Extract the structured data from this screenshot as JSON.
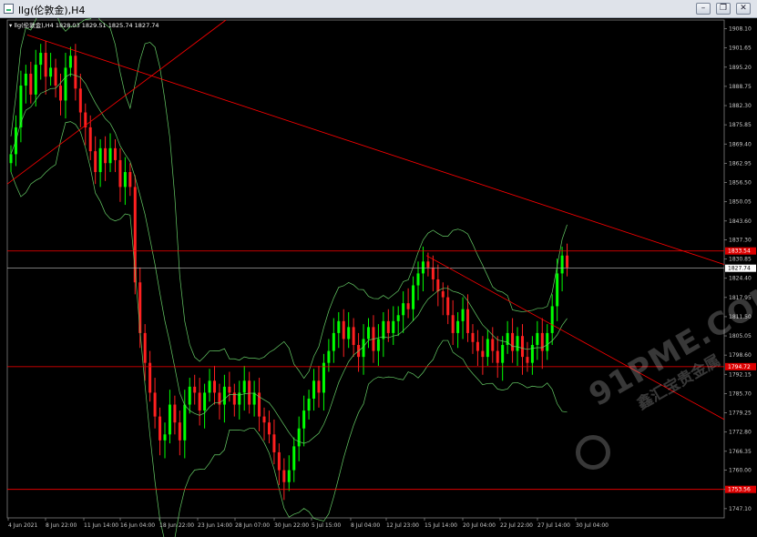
{
  "window": {
    "title": "llg(伦敦金),H4",
    "minimize_glyph": "–",
    "restore_glyph": "❐",
    "close_glyph": "✕"
  },
  "chart_info": {
    "symbol": "llg(伦敦金),H4",
    "ohlc": "1828.03 1829.51 1825.74 1827.74"
  },
  "chart_data": {
    "type": "candlestick",
    "timeframe": "H4",
    "price_ticks": [
      "1908.10",
      "1901.65",
      "1895.20",
      "1888.75",
      "1882.30",
      "1875.85",
      "1869.40",
      "1862.95",
      "1856.50",
      "1850.05",
      "1843.60",
      "1837.30",
      "1830.85",
      "1824.40",
      "1817.95",
      "1811.50",
      "1805.05",
      "1798.60",
      "1792.15",
      "1785.70",
      "1779.25",
      "1772.80",
      "1766.35",
      "1760.00",
      "1753.55",
      "1747.10"
    ],
    "ylim": [
      1744.0,
      1911.0
    ],
    "time_ticks": [
      "4 Jun 2021",
      "8 Jun 22:00",
      "11 Jun 14:00",
      "16 Jun 04:00",
      "18 Jun 22:00",
      "23 Jun 14:00",
      "28 Jun 07:00",
      "30 Jun 22:00",
      "5 Jul 15:00",
      "8 Jul 04:00",
      "12 Jul 23:00",
      "15 Jul 14:00",
      "20 Jul 04:00",
      "22 Jul 22:00",
      "27 Jul 14:00",
      "30 Jul 04:00"
    ],
    "current_price": "1827.74",
    "marked_levels": [
      "1833.54",
      "1794.72",
      "1753.56"
    ],
    "closes": [
      1866,
      1875,
      1889,
      1893,
      1886,
      1896,
      1900,
      1892,
      1895,
      1889,
      1884,
      1895,
      1899,
      1888,
      1880,
      1875,
      1867,
      1860,
      1868,
      1863,
      1868,
      1864,
      1855,
      1860,
      1855,
      1823,
      1806,
      1796,
      1786,
      1778,
      1770,
      1772,
      1782,
      1776,
      1770,
      1782,
      1788,
      1786,
      1780,
      1786,
      1790,
      1786,
      1782,
      1788,
      1786,
      1782,
      1786,
      1790,
      1782,
      1786,
      1778,
      1776,
      1772,
      1766,
      1760,
      1756,
      1760,
      1768,
      1774,
      1780,
      1784,
      1790,
      1786,
      1796,
      1800,
      1806,
      1810,
      1804,
      1808,
      1802,
      1798,
      1804,
      1808,
      1800,
      1804,
      1810,
      1806,
      1810,
      1812,
      1816,
      1814,
      1822,
      1826,
      1830,
      1828,
      1824,
      1820,
      1818,
      1812,
      1806,
      1810,
      1814,
      1806,
      1803,
      1800,
      1798,
      1804,
      1800,
      1796,
      1802,
      1806,
      1800,
      1805,
      1798,
      1796,
      1802,
      1806,
      1800,
      1806,
      1815,
      1826,
      1832,
      1828
    ],
    "colors": {
      "bull": "#00ff00",
      "bear": "#ff2020",
      "bands": "#66cc66",
      "level_lines": "#ff0000",
      "trend_lines": "#ff0000",
      "current_line": "#c0c0c0",
      "grid": "none"
    }
  },
  "watermark": {
    "site": "91PME.COM",
    "name": "鑫汇宝贵金属"
  }
}
